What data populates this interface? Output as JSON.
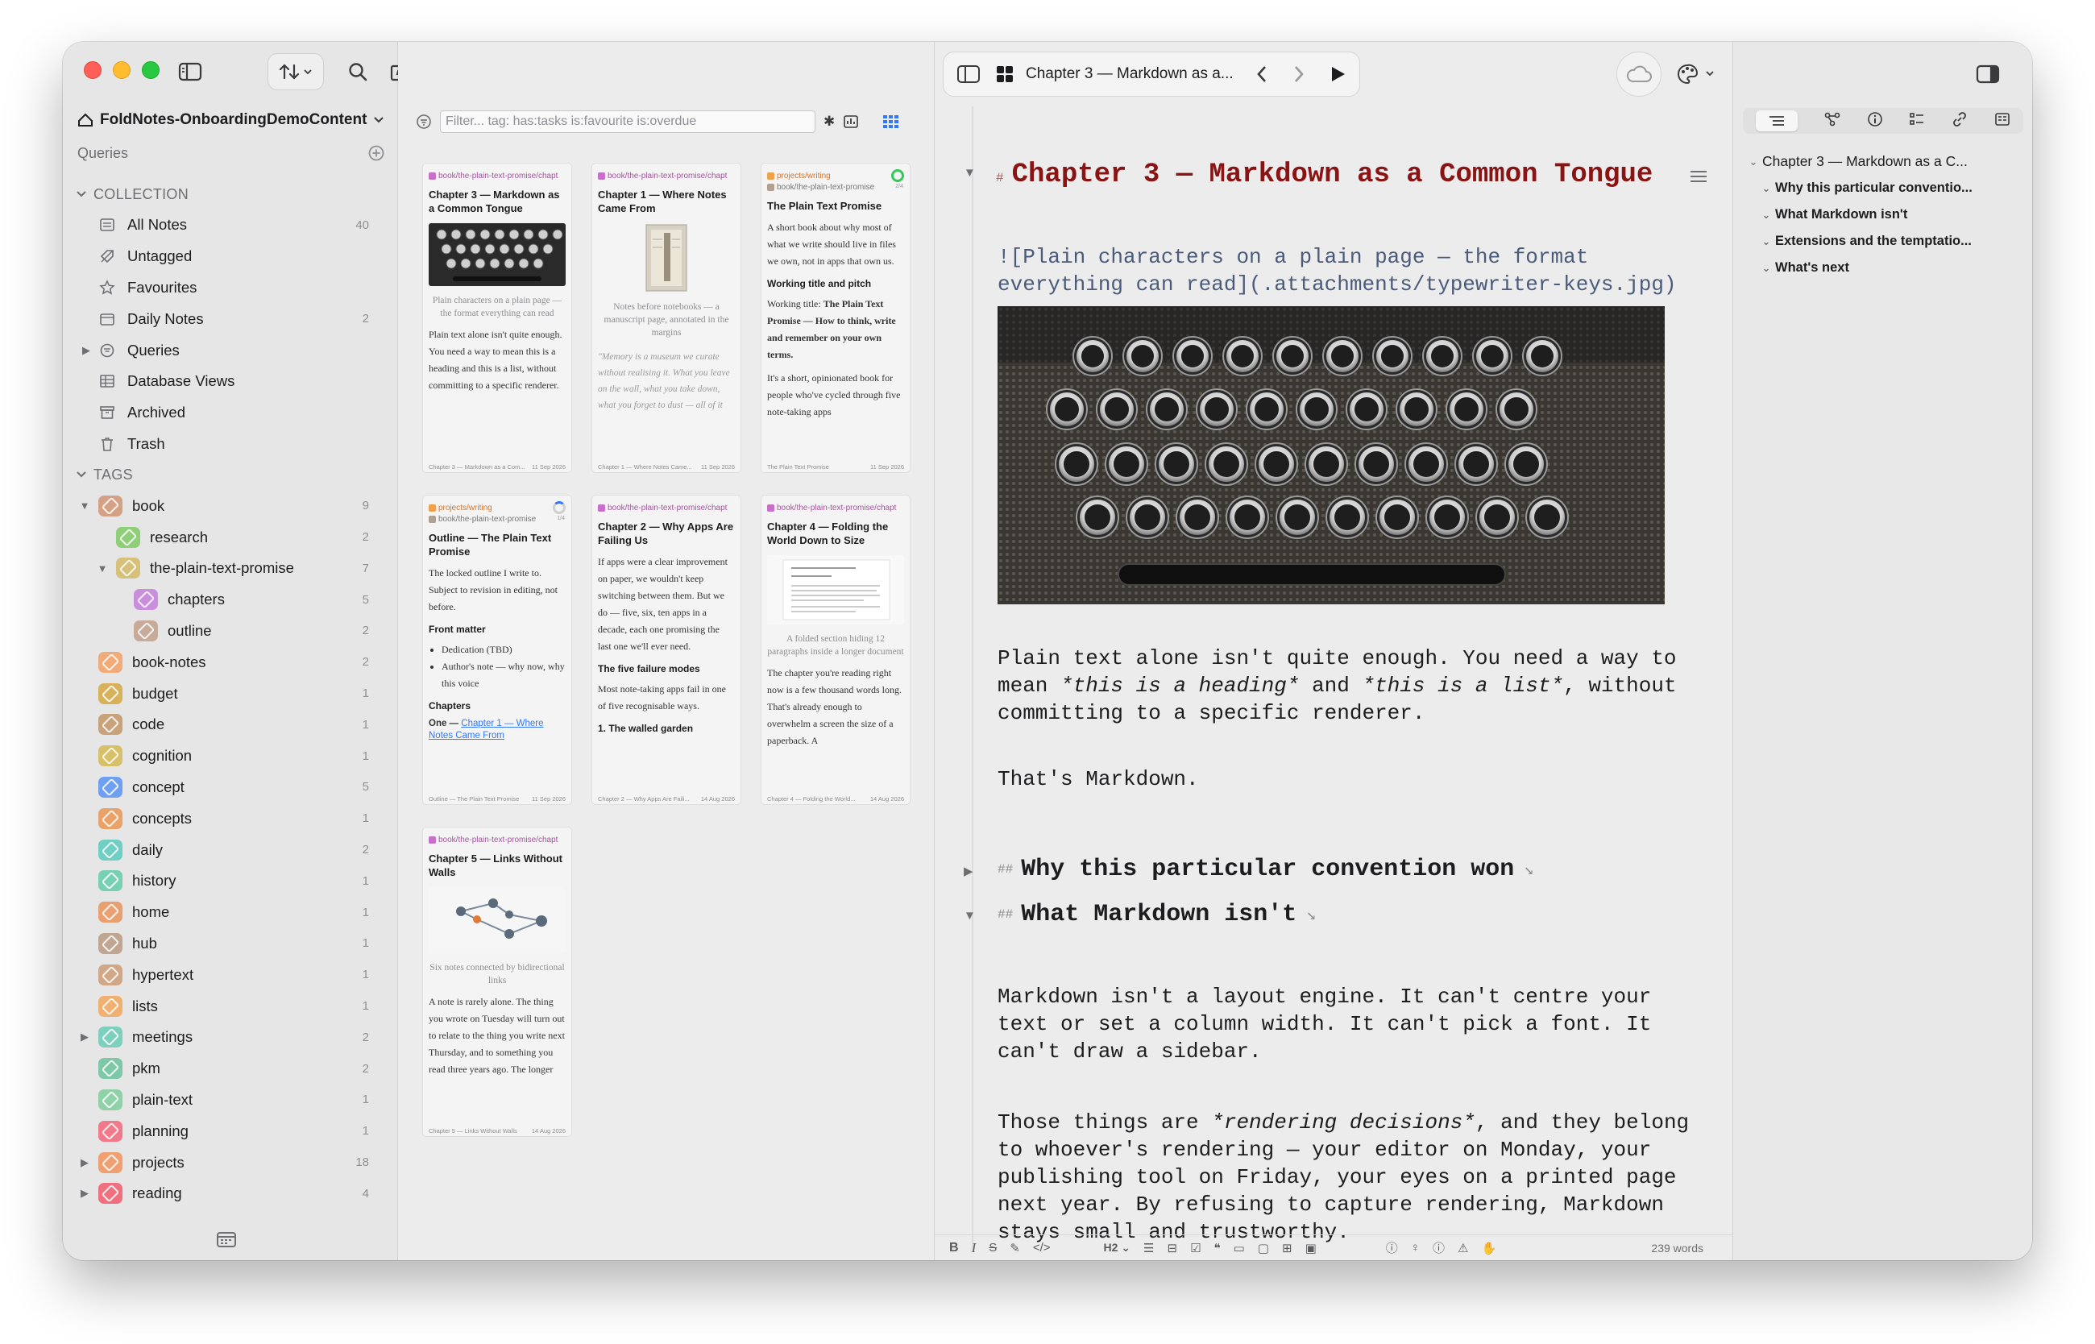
{
  "window": {
    "toolbar": {
      "note_title": "Chapter 3 — Markdown as a...",
      "search_label": "Search",
      "new_note_label": "New note"
    }
  },
  "sidebar": {
    "vault_name": "FoldNotes-OnboardingDemoContent",
    "queries_label": "Queries",
    "collection_header": "COLLECTION",
    "collection": [
      {
        "label": "All Notes",
        "count": "40",
        "icon": "notes-icon"
      },
      {
        "label": "Untagged",
        "count": "",
        "icon": "untagged-icon"
      },
      {
        "label": "Favourites",
        "count": "",
        "icon": "star-icon"
      },
      {
        "label": "Daily Notes",
        "count": "2",
        "icon": "calendar-icon"
      },
      {
        "label": "Queries",
        "count": "",
        "icon": "query-icon",
        "chevron": true
      },
      {
        "label": "Database Views",
        "count": "",
        "icon": "table-icon"
      },
      {
        "label": "Archived",
        "count": "",
        "icon": "archive-icon"
      },
      {
        "label": "Trash",
        "count": "",
        "icon": "trash-icon"
      }
    ],
    "tags_header": "TAGS",
    "tags": [
      {
        "label": "book",
        "count": "9",
        "color": "#d4a184",
        "indent": 0,
        "chevron": "down"
      },
      {
        "label": "research",
        "count": "2",
        "color": "#8fcf7a",
        "indent": 1,
        "chevron": ""
      },
      {
        "label": "the-plain-text-promise",
        "count": "7",
        "color": "#d6c07a",
        "indent": 1,
        "chevron": "down"
      },
      {
        "label": "chapters",
        "count": "5",
        "color": "#c98fdc",
        "indent": 2,
        "chevron": ""
      },
      {
        "label": "outline",
        "count": "2",
        "color": "#c8aa9a",
        "indent": 2,
        "chevron": ""
      },
      {
        "label": "book-notes",
        "count": "2",
        "color": "#f0ab78",
        "indent": 0,
        "chevron": ""
      },
      {
        "label": "budget",
        "count": "1",
        "color": "#d8b25a",
        "indent": 0,
        "chevron": ""
      },
      {
        "label": "code",
        "count": "1",
        "color": "#c8a27a",
        "indent": 0,
        "chevron": ""
      },
      {
        "label": "cognition",
        "count": "1",
        "color": "#d6c06a",
        "indent": 0,
        "chevron": ""
      },
      {
        "label": "concept",
        "count": "5",
        "color": "#6f9ff0",
        "indent": 0,
        "chevron": ""
      },
      {
        "label": "concepts",
        "count": "1",
        "color": "#e9a36a",
        "indent": 0,
        "chevron": ""
      },
      {
        "label": "daily",
        "count": "2",
        "color": "#6fcfc2",
        "indent": 0,
        "chevron": ""
      },
      {
        "label": "history",
        "count": "1",
        "color": "#78d0b4",
        "indent": 0,
        "chevron": ""
      },
      {
        "label": "home",
        "count": "1",
        "color": "#e8a070",
        "indent": 0,
        "chevron": ""
      },
      {
        "label": "hub",
        "count": "1",
        "color": "#c0a592",
        "indent": 0,
        "chevron": ""
      },
      {
        "label": "hypertext",
        "count": "1",
        "color": "#d0a888",
        "indent": 0,
        "chevron": ""
      },
      {
        "label": "lists",
        "count": "1",
        "color": "#f0b070",
        "indent": 0,
        "chevron": ""
      },
      {
        "label": "meetings",
        "count": "2",
        "color": "#7ed0be",
        "indent": 0,
        "chevron": "right"
      },
      {
        "label": "pkm",
        "count": "2",
        "color": "#7ec8a8",
        "indent": 0,
        "chevron": ""
      },
      {
        "label": "plain-text",
        "count": "1",
        "color": "#8fd2a8",
        "indent": 0,
        "chevron": ""
      },
      {
        "label": "planning",
        "count": "1",
        "color": "#f07a8a",
        "indent": 0,
        "chevron": ""
      },
      {
        "label": "projects",
        "count": "18",
        "color": "#f0a070",
        "indent": 0,
        "chevron": "right"
      },
      {
        "label": "reading",
        "count": "4",
        "color": "#f07080",
        "indent": 0,
        "chevron": "right"
      }
    ]
  },
  "notes_list": {
    "filter_placeholder": "Filter...  tag:  has:tasks  is:favourite  is:overdue",
    "cards": [
      {
        "tag": "book/the-plain-text-promise/chapt",
        "tag2": "",
        "title": "Chapter 3 — Markdown as a Common Tongue",
        "image": "typewriter",
        "caption": "Plain characters on a plain page — the format everything can read",
        "body": "Plain text alone isn't quite enough. You need a way to mean this is a heading and this is a list, without committing to a specific renderer.",
        "foot_left": "Chapter 3 — Markdown as a Com...",
        "foot_right": "11 Sep 2026"
      },
      {
        "tag": "book/the-plain-text-promise/chapt",
        "tag2": "",
        "title": "Chapter 1 — Where Notes Came From",
        "image": "notebook",
        "caption": "Notes before notebooks — a manuscript page, annotated in the margins",
        "quote": "\"Memory is a museum we curate without realising it. What you leave on the wall, what you take down, what you forget to dust — all of it",
        "foot_left": "Chapter 1 — Where Notes Came...",
        "foot_right": "11 Sep 2026"
      },
      {
        "tag": "projects/writing",
        "tag2": "book/the-plain-text-promise",
        "title": "The Plain Text Promise",
        "progress": "2/4",
        "body": "A short book about why most of what we write should live in files we own, not in apps that own us.",
        "sub1": "Working title and pitch",
        "body2_prefix": "Working title: ",
        "body2_bold": "The Plain Text Promise — How to think, write and remember on your own terms.",
        "body3": "It's a short, opinionated book for people who've cycled through five note-taking apps",
        "foot_left": "The Plain Text Promise",
        "foot_right": "11 Sep 2026"
      },
      {
        "tag": "projects/writing",
        "tag2": "book/the-plain-text-promise",
        "title": "Outline — The Plain Text Promise",
        "progress": "1/4",
        "body": "The locked outline I write to. Subject to revision in editing, not before.",
        "sub1": "Front matter",
        "bullets": [
          "Dedication (TBD)",
          "Author's note — why now, why this voice"
        ],
        "sub2": "Chapters",
        "link_prefix": "One — ",
        "link_text": "Chapter 1 — Where Notes Came From",
        "foot_left": "Outline — The Plain Text Promise",
        "foot_right": "11 Sep 2026"
      },
      {
        "tag": "book/the-plain-text-promise/chapt",
        "tag2": "",
        "title": "Chapter 2 — Why Apps Are Failing Us",
        "body": "If apps were a clear improvement on paper, we wouldn't keep switching between them. But we do — five, six, ten apps in a decade, each one promising the last one we'll ever need.",
        "sub1": "The five failure modes",
        "body2": "Most note-taking apps fail in one of five recognisable ways.",
        "sub2": "1. The walled garden",
        "foot_left": "Chapter 2 — Why Apps Are Faili...",
        "foot_right": "14 Aug 2026"
      },
      {
        "tag": "book/the-plain-text-promise/chapt",
        "tag2": "",
        "title": "Chapter 4 — Folding the World Down to Size",
        "image": "document",
        "caption": "A folded section hiding 12 paragraphs inside a longer document",
        "body": "The chapter you're reading right now is a few thousand words long. That's already enough to overwhelm a screen the size of a paperback. A",
        "foot_left": "Chapter 4 — Folding the World...",
        "foot_right": "14 Aug 2026"
      },
      {
        "tag": "book/the-plain-text-promise/chapt",
        "tag2": "",
        "title": "Chapter 5 — Links Without Walls",
        "image": "graph",
        "caption": "Six notes connected by bidirectional links",
        "body": "A note is rarely alone. The thing you wrote on Tuesday will turn out to relate to the thing you write next Thursday, and to something you read three years ago. The longer",
        "foot_left": "Chapter 5 — Links Without Walls",
        "foot_right": "14 Aug 2026"
      }
    ]
  },
  "editor": {
    "heading_marker": "#",
    "h1": "Chapter 3 — Markdown as a Common Tongue",
    "image_md_line1": "![Plain characters on a plain page — the format",
    "image_md_line2": "everything can read](.attachments/typewriter-keys.jpg)",
    "para1_line1": "Plain text alone isn't quite enough. You need a way to",
    "para1_l2_a": "mean ",
    "para1_l2_em1": "*this is a heading*",
    "para1_l2_b": " and ",
    "para1_l2_em2": "*this is a list*",
    "para1_l2_c": ", without",
    "para1_line3": "committing to a specific renderer.",
    "para2": "That's Markdown.",
    "h2_marker": "##",
    "h2a": "Why this particular convention won",
    "h2b": "What Markdown isn't",
    "para3_line1": "Markdown isn't a layout engine. It can't centre your",
    "para3_line2": "text or set a column width. It can't pick a font. It",
    "para3_line3": "can't draw a sidebar.",
    "para4_l1_a": "Those things are ",
    "para4_l1_em": "*rendering decisions*",
    "para4_l1_b": ", and they belong",
    "para4_line2": "to whoever's rendering — your editor on Monday, your",
    "para4_line3": "publishing tool on Friday, your eyes on a printed page",
    "para4_line4": "next year. By refusing to capture rendering, Markdown",
    "para4_line5": "stays small and trustworthy.",
    "status": {
      "bold": "B",
      "italic": "I",
      "strike": "S",
      "heading_level": "H2",
      "word_count": "239 words"
    }
  },
  "outline": {
    "items": [
      {
        "label": "Chapter 3 — Markdown as a C...",
        "level": 1
      },
      {
        "label": "Why this particular conventio...",
        "level": 2
      },
      {
        "label": "What Markdown isn't",
        "level": 2
      },
      {
        "label": "Extensions and the temptatio...",
        "level": 2
      },
      {
        "label": "What's next",
        "level": 2
      }
    ]
  }
}
